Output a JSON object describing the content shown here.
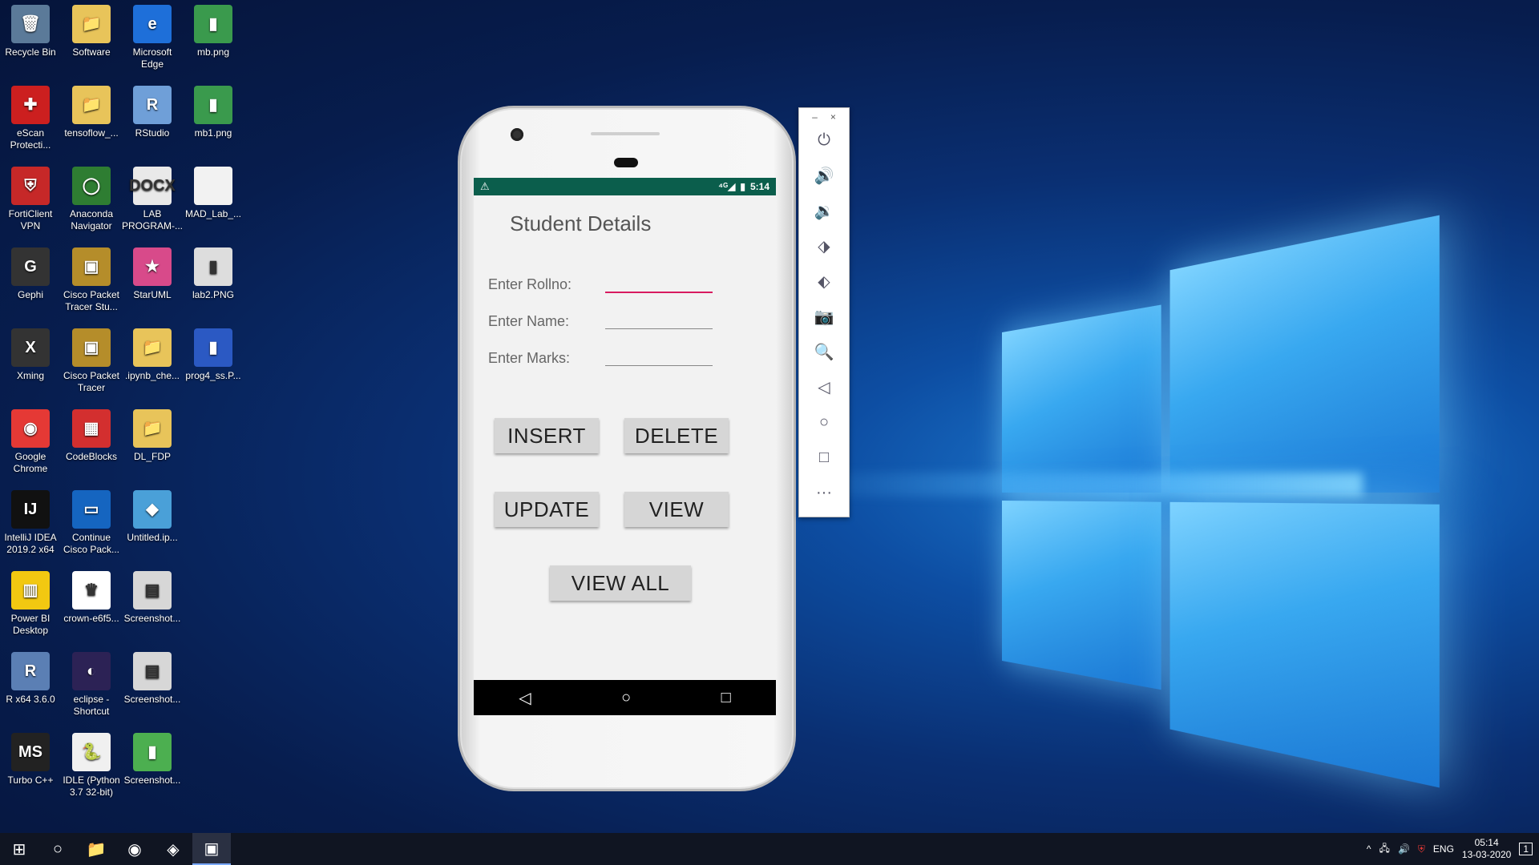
{
  "desktop": {
    "icons": [
      {
        "label": "Recycle Bin",
        "glyph": "🗑",
        "color": "#5b7a99"
      },
      {
        "label": "Software",
        "glyph": "📁",
        "color": "#e8c45a"
      },
      {
        "label": "Microsoft Edge",
        "glyph": "e",
        "color": "#1e6fd9"
      },
      {
        "label": "mb.png",
        "glyph": "▮",
        "color": "#3a9a4d"
      },
      {
        "label": "eScan Protecti...",
        "glyph": "✚",
        "color": "#cc1f1f"
      },
      {
        "label": "tensoflow_...",
        "glyph": "📁",
        "color": "#e8c45a"
      },
      {
        "label": "RStudio",
        "glyph": "R",
        "color": "#6f9fd8"
      },
      {
        "label": "mb1.png",
        "glyph": "▮",
        "color": "#3a9a4d"
      },
      {
        "label": "FortiClient VPN",
        "glyph": "⛨",
        "color": "#c62828"
      },
      {
        "label": "Anaconda Navigator",
        "glyph": "◯",
        "color": "#2e7d32"
      },
      {
        "label": "LAB PROGRAM-...",
        "glyph": "DOCX",
        "color": "#e9e9e9"
      },
      {
        "label": "MAD_Lab_...",
        "glyph": "",
        "color": "#f2f2f2"
      },
      {
        "label": "Gephi",
        "glyph": "G",
        "color": "#333333"
      },
      {
        "label": "Cisco Packet Tracer Stu...",
        "glyph": "▣",
        "color": "#b58d2a"
      },
      {
        "label": "StarUML",
        "glyph": "★",
        "color": "#d84a8a"
      },
      {
        "label": "lab2.PNG",
        "glyph": "▮",
        "color": "#dddddd"
      },
      {
        "label": "Xming",
        "glyph": "X",
        "color": "#333333"
      },
      {
        "label": "Cisco Packet Tracer",
        "glyph": "▣",
        "color": "#b58d2a"
      },
      {
        "label": ".ipynb_che...",
        "glyph": "📁",
        "color": "#e8c45a"
      },
      {
        "label": "prog4_ss.P...",
        "glyph": "▮",
        "color": "#2b59c3"
      },
      {
        "label": "Google Chrome",
        "glyph": "◉",
        "color": "#e53935"
      },
      {
        "label": "CodeBlocks",
        "glyph": "▦",
        "color": "#d32f2f"
      },
      {
        "label": "DL_FDP",
        "glyph": "📁",
        "color": "#e8c45a"
      },
      {
        "label": "",
        "glyph": "",
        "color": "transparent"
      },
      {
        "label": "IntelliJ IDEA 2019.2 x64",
        "glyph": "IJ",
        "color": "#111111"
      },
      {
        "label": "Continue Cisco Pack...",
        "glyph": "▭",
        "color": "#1565c0"
      },
      {
        "label": "Untitled.ip...",
        "glyph": "◆",
        "color": "#4aa0d8"
      },
      {
        "label": "",
        "glyph": "",
        "color": "transparent"
      },
      {
        "label": "Power BI Desktop",
        "glyph": "▥",
        "color": "#f2c811"
      },
      {
        "label": "crown-e6f5...",
        "glyph": "♛",
        "color": "#ffffff"
      },
      {
        "label": "Screenshot...",
        "glyph": "▤",
        "color": "#d7d7d7"
      },
      {
        "label": "",
        "glyph": "",
        "color": "transparent"
      },
      {
        "label": "R x64 3.6.0",
        "glyph": "R",
        "color": "#5b7fb4"
      },
      {
        "label": "eclipse - Shortcut",
        "glyph": "◐",
        "color": "#2c2255"
      },
      {
        "label": "Screenshot...",
        "glyph": "▤",
        "color": "#d7d7d7"
      },
      {
        "label": "",
        "glyph": "",
        "color": "transparent"
      },
      {
        "label": "Turbo C++",
        "glyph": "MS",
        "color": "#222222"
      },
      {
        "label": "IDLE (Python 3.7 32-bit)",
        "glyph": "🐍",
        "color": "#f0f0f0"
      },
      {
        "label": "Screenshot...",
        "glyph": "▮",
        "color": "#4caf50"
      }
    ]
  },
  "phone": {
    "status": {
      "warning": "⚠",
      "signal": "⁴ᴳ◢",
      "battery": "▮",
      "time": "5:14"
    },
    "app_title": "Student Details",
    "labels": {
      "rollno": "Enter Rollno:",
      "name": "Enter Name:",
      "marks": "Enter Marks:"
    },
    "buttons": {
      "insert": "INSERT",
      "delete": "DELETE",
      "update": "UPDATE",
      "view": "VIEW",
      "view_all": "VIEW ALL"
    },
    "nav": {
      "back": "◁",
      "home": "○",
      "recent": "□"
    }
  },
  "emulator_toolbar": {
    "minimize": "–",
    "close": "×",
    "tools": [
      "⏻",
      "🔊",
      "🔉",
      "⬗",
      "⬖",
      "📷",
      "🔍",
      "◁",
      "○",
      "□",
      "···"
    ]
  },
  "taskbar": {
    "start": "⊞",
    "search": "○",
    "apps": [
      {
        "name": "file-explorer",
        "glyph": "📁"
      },
      {
        "name": "chrome",
        "glyph": "◉"
      },
      {
        "name": "android-studio",
        "glyph": "◈"
      },
      {
        "name": "emulator",
        "glyph": "▣"
      }
    ],
    "tray": {
      "chevron": "^",
      "network": "🖧",
      "volume": "🔊",
      "shield": "⛨",
      "lang": "ENG",
      "time": "05:14",
      "date": "13-03-2020",
      "notifications": "1"
    }
  },
  "colors": {
    "accent": "#d81b60",
    "statusbar": "#0b5e4c"
  }
}
